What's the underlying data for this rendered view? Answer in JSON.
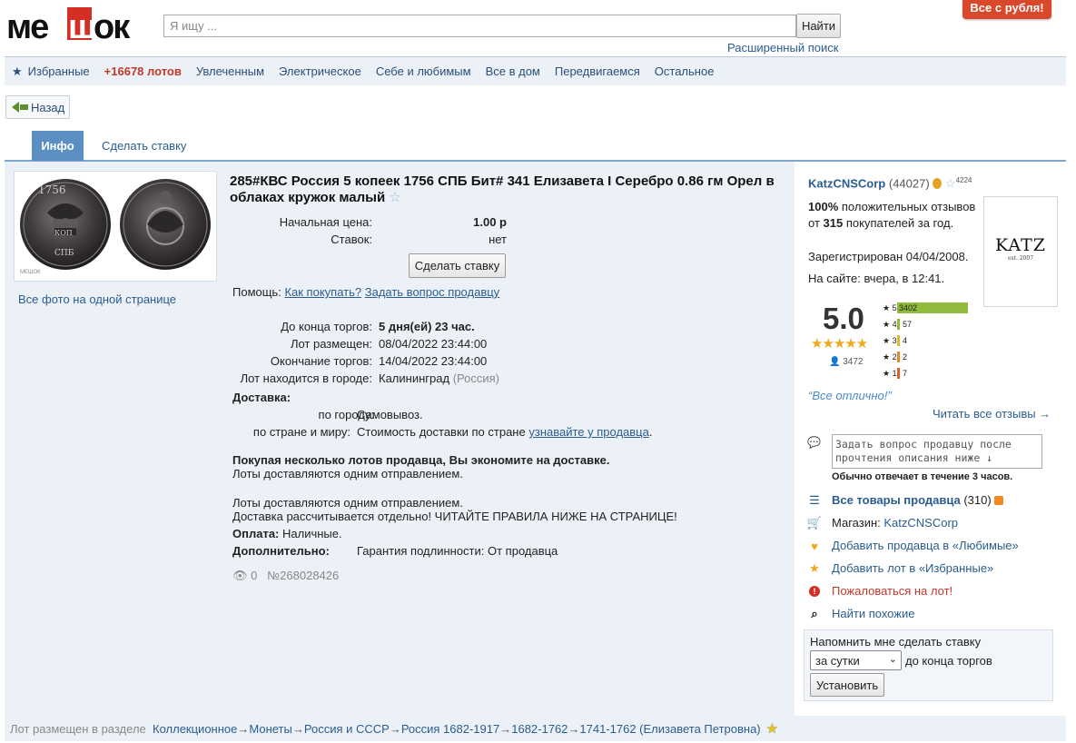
{
  "header": {
    "logo_text": "мешок",
    "search_placeholder": "Я ищу ...",
    "find_button": "Найти",
    "advanced_search": "Расширенный поиск",
    "promo": "Все с рубля!"
  },
  "nav": {
    "items": [
      "Избранные",
      "+16678 лотов",
      "Увлеченным",
      "Электрическое",
      "Себе и любимым",
      "Все в дом",
      "Передвигаемся",
      "Остальное"
    ]
  },
  "back_label": "Назад",
  "tabs": {
    "info": "Инфо",
    "bid": "Сделать ставку"
  },
  "lot": {
    "title": "285#КВС Россия 5 копеек 1756 СПБ Бит# 341 Елизавета I Серебро 0.86 гм Орел в облаках кружок малый",
    "all_photos": "Все фото на одной странице",
    "start_price_label": "Начальная цена:",
    "start_price": "1.00 р",
    "bids_label": "Ставок:",
    "bids": "нет",
    "bid_button": "Сделать ставку",
    "help_label": "Помощь:",
    "help_how": "Как покупать?",
    "help_ask": "Задать вопрос продавцу",
    "ends_in_label": "До конца торгов:",
    "ends_in": "5 дня(ей) 23 час.",
    "placed_label": "Лот размещен:",
    "placed": "08/04/2022 23:44:00",
    "end_label": "Окончание торгов:",
    "end": "14/04/2022 23:44:00",
    "city_label": "Лот находится в городе:",
    "city": "Калининград",
    "country": "(Россия)",
    "delivery_label": "Доставка:",
    "city_delivery_label": "по городу:",
    "city_delivery": "Самовывоз.",
    "world_delivery_label": "по стране и миру:",
    "world_delivery": "Стоимость доставки по стране",
    "world_delivery_link": "узнавайте у продавца",
    "multi_bold": "Покупая несколько лотов продавца, Вы экономите на доставке.",
    "multi_text": "Лоты доставляются одним отправлением.",
    "note1": "Лоты доставляются одним отправлением.",
    "note2": "Доставка рассчитывается отдельно! ЧИТАЙТЕ ПРАВИЛА НИЖЕ НА СТРАНИЦЕ!",
    "payment_label": "Оплата:",
    "payment": "Наличные.",
    "extra_label": "Дополнительно:",
    "extra": "Гарантия подлинности: От продавца",
    "views": "0",
    "lot_number": "№268028426"
  },
  "seller": {
    "name": "KatzCNSCorp",
    "count": "(44027)",
    "stars_count": "4224",
    "positive_pct": "100%",
    "positive_text": "положительных отзывов от",
    "buyers": "315",
    "buyers_text": "покупателей за год.",
    "registered": "Зарегистрирован 04/04/2008.",
    "online": "На сайте: вчера, в 12:41.",
    "logo_text": "KATZ",
    "logo_sub": "est. 2007",
    "score": "5.0",
    "reviews_total": "3472",
    "ratings": [
      {
        "star": "5",
        "count": "3402",
        "fraction": 1.0,
        "color": "#8fba3c"
      },
      {
        "star": "4",
        "count": "57",
        "fraction": 0.02,
        "color": "#8fba3c"
      },
      {
        "star": "3",
        "count": "4",
        "fraction": 0.01,
        "color": "#e0b82a"
      },
      {
        "star": "2",
        "count": "2",
        "fraction": 0.01,
        "color": "#e08a2a"
      },
      {
        "star": "1",
        "count": "7",
        "fraction": 0.01,
        "color": "#e0602a"
      }
    ],
    "quote": "“Все отлично!”",
    "read_all": "Читать все отзывы →",
    "ask_placeholder": "Задать вопрос продавцу после прочтения описания ниже ↓",
    "replies": "Обычно отвечает в течение 3 часов.",
    "all_goods": "Все товары продавца",
    "all_goods_count": "(310)",
    "shop_label": "Магазин:",
    "shop": "KatzCNSCorp",
    "add_fav_seller": "Добавить продавца в «Любимые»",
    "add_fav_lot": "Добавить лот в «Избранные»",
    "complain": "Пожаловаться на лот!",
    "similar": "Найти похожие",
    "remind_label": "Напомнить мне сделать ставку",
    "remind_option": "за сутки",
    "remind_suffix": "до конца торгов",
    "set_button": "Установить"
  },
  "footer": {
    "label": "Лот размещен в разделе",
    "crumbs": [
      "Коллекционное",
      "Монеты",
      "Россия и СССР",
      "Россия 1682-1917",
      "1682-1762",
      "1741-1762 (Елизавета Петровна)"
    ]
  }
}
